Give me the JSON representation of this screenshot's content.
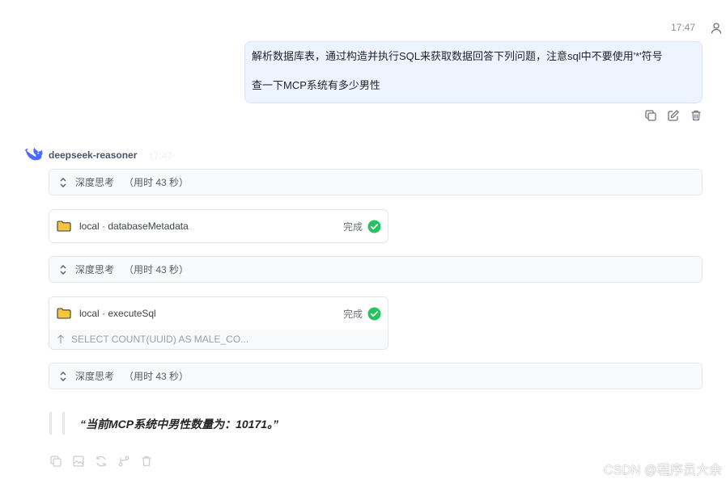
{
  "user_message": {
    "time": "17:47",
    "line1": "解析数据库表，通过构造并执行SQL来获取数据回答下列问题，注意sql中不要使用'*'符号",
    "line2": "查一下MCP系统有多少男性"
  },
  "assistant": {
    "name": "deepseek-reasoner",
    "time": "17:47",
    "think_blocks": [
      {
        "label": "深度思考",
        "duration": "（用时 43 秒）"
      },
      {
        "label": "深度思考",
        "duration": "（用时 43 秒）"
      },
      {
        "label": "深度思考",
        "duration": "（用时 43 秒）"
      }
    ],
    "tool_calls": [
      {
        "name": "local · databaseMetadata",
        "status": "完成"
      },
      {
        "name": "local · executeSql",
        "status": "完成",
        "preview": "SELECT COUNT(UUID) AS MALE_CO..."
      }
    ],
    "answer": "“当前MCP系统中男性数量为：10171。”"
  },
  "watermark": "CSDN @程序员大余",
  "colors": {
    "user_bubble_bg": "#edf4ff",
    "success_green": "#22c55e",
    "folder_yellow": "#f5c542",
    "brand_blue": "#4d6bfe"
  },
  "icons": {
    "user": "user-icon",
    "copy": "copy-icon",
    "edit": "edit-icon",
    "delete": "trash-icon",
    "logo": "deepseek-whale-icon",
    "expand": "chevron-updown-icon",
    "folder": "folder-icon",
    "check": "check-circle-icon"
  }
}
